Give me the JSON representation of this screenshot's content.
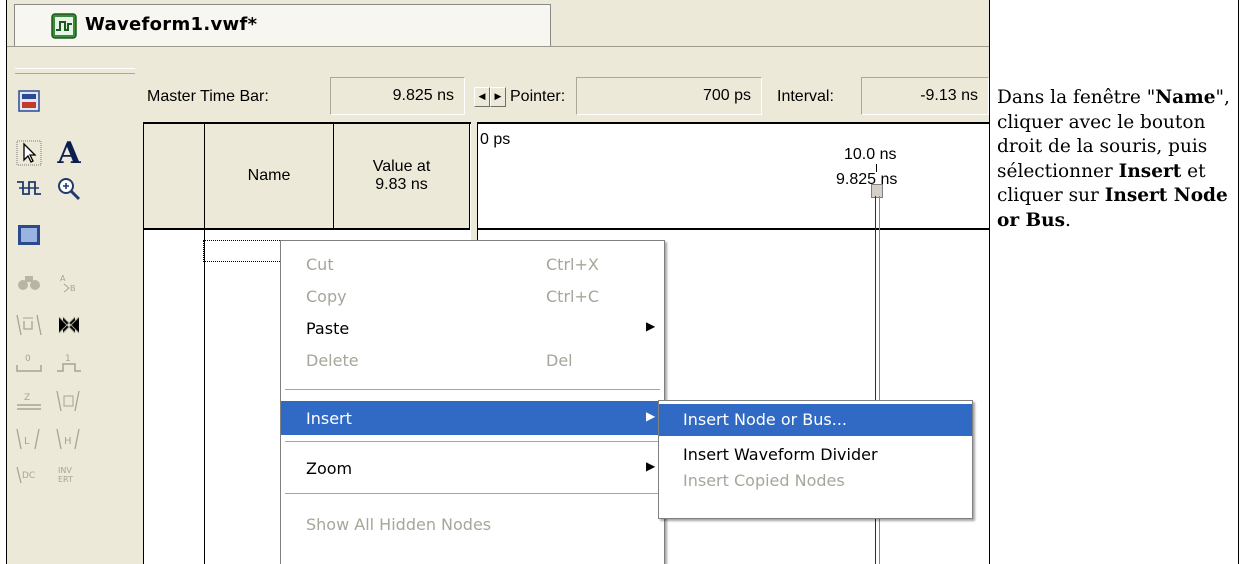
{
  "tab": {
    "title": "Waveform1.vwf*",
    "icon": "waveform-file-icon"
  },
  "toolbar": {
    "icons": [
      "file-properties-icon",
      "selection-tool-icon",
      "text-tool-icon",
      "waveform-editing-tool-icon",
      "zoom-tool-icon",
      "full-screen-icon",
      "find-icon",
      "replace-icon",
      "invert-icon",
      "count-value-icon",
      "forcing-low-icon",
      "forcing-high-icon",
      "weak-low-icon",
      "weak-high-icon",
      "unknown-icon",
      "high-impedance-icon",
      "dont-care-icon",
      "invert-value-icon"
    ]
  },
  "timebar": {
    "master_label": "Master Time Bar:",
    "master_value": "9.825 ns",
    "pointer_label": "Pointer:",
    "pointer_value": "700 ps",
    "interval_label": "Interval:",
    "interval_value": "-9.13 ns"
  },
  "grid": {
    "name_header": "Name",
    "value_header_line1": "Value at",
    "value_header_line2": "9.83 ns"
  },
  "wave": {
    "start_label": "0 ps",
    "tick_label": "10.0 ns",
    "cursor_label": "9.825 ns"
  },
  "menu": {
    "items": [
      {
        "label": "Cut",
        "shortcut": "Ctrl+X",
        "disabled": true
      },
      {
        "label": "Copy",
        "shortcut": "Ctrl+C",
        "disabled": true
      },
      {
        "label": "Paste",
        "submenu": true
      },
      {
        "label": "Delete",
        "shortcut": "Del",
        "disabled": true
      },
      {
        "label": "Insert",
        "submenu": true,
        "selected": true
      },
      {
        "label": "Zoom",
        "submenu": true
      },
      {
        "label": "Show All Hidden Nodes",
        "disabled": true
      }
    ]
  },
  "submenu": {
    "items": [
      {
        "label": "Insert Node or Bus...",
        "selected": true
      },
      {
        "label": "Insert Waveform Divider"
      },
      {
        "label": "Insert Copied Nodes",
        "disabled": true
      }
    ]
  },
  "instruction": {
    "p1": "Dans la fenêtre \"",
    "b1": "Name",
    "p2": "\", cliquer avec le bouton droit de la souris, puis sélectionner ",
    "b2": "Insert",
    "p3": " et cliquer sur ",
    "b3": "Insert Node or Bus",
    "p4": "."
  },
  "colors": {
    "menu_highlight": "#316ac5",
    "chrome": "#ece9d8",
    "cursor": "#2020a0"
  }
}
